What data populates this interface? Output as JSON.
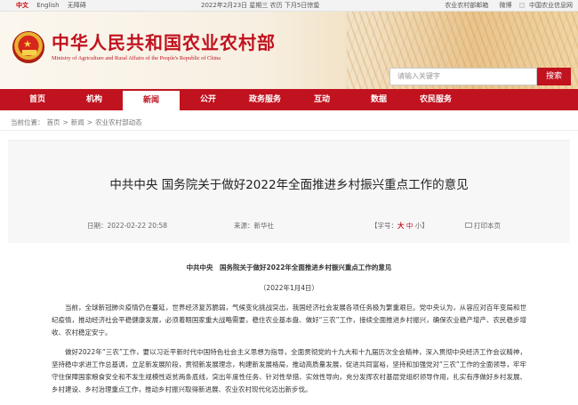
{
  "topbar": {
    "lang_cn": "中文",
    "lang_en": "English",
    "accessibility": "无障碍",
    "date": "2022年2月23日 星期三 农历 下月5日惊蛰",
    "mail": "农业农村部邮箱",
    "weibo": "微博",
    "info_publish": "中国农业信息网"
  },
  "banner": {
    "ministry_cn": "中华人民共和国农业农村部",
    "ministry_en": "Ministry of Agriculture and Rural Affairs of the People's Republic of China",
    "search_placeholder": "请输入关键字",
    "search_button": "搜索"
  },
  "nav": [
    "首页",
    "机构",
    "新闻",
    "公开",
    "政务服务",
    "互动",
    "数据",
    "农民服务"
  ],
  "nav_active": "新闻",
  "breadcrumb": {
    "label": "当前位置：",
    "items": [
      "首页",
      "新闻",
      "农业农村部动态"
    ],
    "sep": ">"
  },
  "article": {
    "title": "中共中央 国务院关于做好2022年全面推进乡村振兴重点工作的意见",
    "date": "日期：2022-02-22 20:58",
    "source": "来源：新华社",
    "font_prefix": "【字号：",
    "font_large": "大",
    "font_medium": "中",
    "font_small": "小",
    "font_suffix": "】",
    "print": "打印本页",
    "sub_title": "中共中央　国务院关于做好2022年全面推进乡村振兴重点工作的意见",
    "sub_date": "（2022年1月4日）",
    "paragraphs": [
      "当前，全球新冠肺炎疫情仍在蔓延，世界经济复苏脆弱，气候变化挑战突出，我国经济社会发展各项任务极为繁重艰巨。党中央认为，从容应对百年变局和世纪疫情，推动经济社会平稳健康发展，必须着眼国家重大战略需要，稳住农业基本盘、做好“三农”工作，接续全面推进乡村振兴，确保农业稳产增产、农民稳步增收、农村稳定安宁。",
      "做好2022年“三农”工作，要以习近平新时代中国特色社会主义思想为指导，全面贯彻党的十九大和十九届历次全会精神，深入贯彻中央经济工作会议精神，坚持稳中求进工作总基调，立足新发展阶段，贯彻新发展理念，构建新发展格局，推动高质量发展，促进共同富裕，坚持和加强党对“三农”工作的全面领导，牢牢守住保障国家粮食安全和不发生规模性返贫两条底线，突出年度性任务、针对性举措、实效性导向，充分发挥农村基层党组织领导作用，扎实有序做好乡村发展、乡村建设、乡村治理重点工作，推动乡村振兴取得新进展、农业农村现代化迈出新步伐。"
    ]
  },
  "colors": {
    "brand_red": "#c1121f",
    "nav_text": "#ffffff",
    "head_bg": "#f7f7f7"
  }
}
